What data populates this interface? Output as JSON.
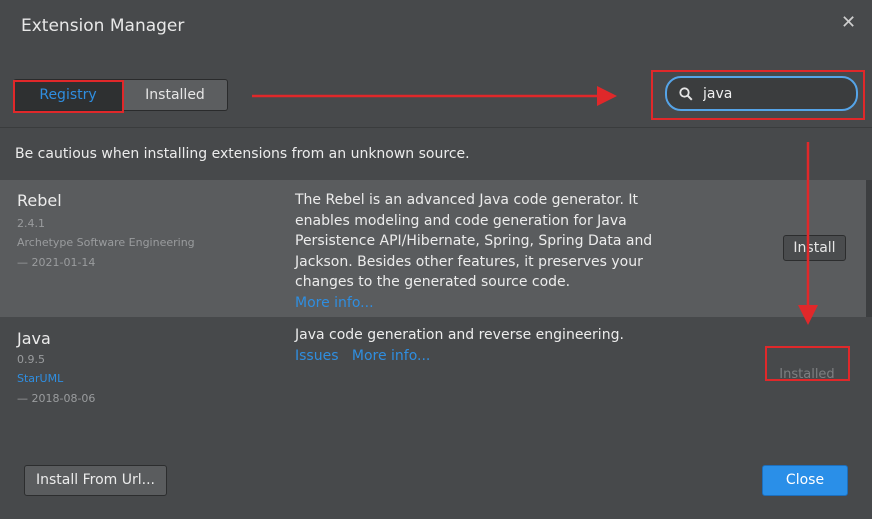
{
  "dialog": {
    "title": "Extension Manager",
    "close_glyph": "✕"
  },
  "tabs": [
    {
      "label": "Registry",
      "active": true
    },
    {
      "label": "Installed",
      "active": false
    }
  ],
  "search": {
    "value": "java",
    "icon": "search-icon"
  },
  "warning": "Be cautious when installing extensions from an unknown source.",
  "extensions": [
    {
      "name": "Rebel",
      "version": "2.4.1",
      "author": "Archetype Software Engineering",
      "date": "— 2021-01-14",
      "description": "The Rebel is an advanced Java code generator. It enables modeling and code generation for Java Persistence API/Hibernate, Spring, Spring Data and Jackson. Besides other features, it preserves your changes to the generated source code.",
      "links": [
        "More info..."
      ],
      "action": "Install"
    },
    {
      "name": "Java",
      "version": "0.9.5",
      "author": "StarUML",
      "date": "— 2018-08-06",
      "description": "Java code generation and reverse engineering.",
      "links": [
        "Issues",
        "More info..."
      ],
      "action": "Installed"
    }
  ],
  "footer": {
    "install_from_url": "Install From Url...",
    "close": "Close"
  },
  "colors": {
    "accent": "#2a8fe8",
    "link": "#2f8ee0",
    "annotation": "#e0282a",
    "background": "#47494b"
  }
}
